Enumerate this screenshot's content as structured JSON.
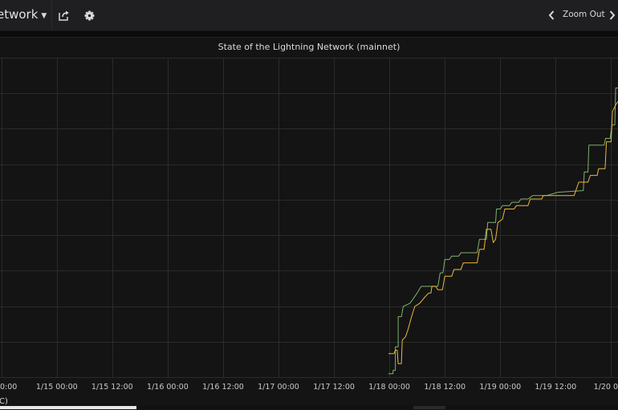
{
  "navbar": {
    "dashboard_title": "etwork",
    "share_icon": "share-icon",
    "settings_icon": "gear-icon",
    "zoom_out_label": "Zoom Out",
    "zoom_prev_icon": "chevron-left-icon",
    "zoom_next_icon": "chevron-right-icon"
  },
  "panel": {
    "title": "State of the Lightning Network (mainnet)",
    "legend_fragment": "C)"
  },
  "colors": {
    "series_green": "#7eb26d",
    "series_orange": "#eab839",
    "grid": "#2b2b2b",
    "background": "#141414"
  },
  "chart_data": {
    "type": "line",
    "title": "State of the Lightning Network (mainnet)",
    "xlabel": "",
    "ylabel": "",
    "grid": true,
    "y_ticks_visible": false,
    "x_tick_labels": [
      "0:00",
      "1/15 00:00",
      "1/15 12:00",
      "1/16 00:00",
      "1/16 12:00",
      "1/17 00:00",
      "1/17 12:00",
      "1/18 00:00",
      "1/18 12:00",
      "1/19 00:00",
      "1/19 12:00",
      "1/20 0"
    ],
    "x_hours": [
      -12,
      0,
      12,
      24,
      36,
      48,
      60,
      72,
      84,
      96,
      108,
      120
    ],
    "xlim_hours": [
      -12.3,
      121.5
    ],
    "ylim": [
      -0.1,
      9.4
    ],
    "series": [
      {
        "color": "#7eb26d",
        "points": [
          [
            71.8,
            0.0
          ],
          [
            72.8,
            0.0
          ],
          [
            72.8,
            0.1
          ],
          [
            73.3,
            0.1
          ],
          [
            73.3,
            0.8
          ],
          [
            73.9,
            0.8
          ],
          [
            73.9,
            1.7
          ],
          [
            74.6,
            1.7
          ],
          [
            75.0,
            2.0
          ],
          [
            76.5,
            2.1
          ],
          [
            78.0,
            2.4
          ],
          [
            78.9,
            2.6
          ],
          [
            80.5,
            2.6
          ],
          [
            82.5,
            2.6
          ],
          [
            83.0,
            3.0
          ],
          [
            83.6,
            3.0
          ],
          [
            84.0,
            3.4
          ],
          [
            85.0,
            3.4
          ],
          [
            85.5,
            3.5
          ],
          [
            87.0,
            3.5
          ],
          [
            87.5,
            3.6
          ],
          [
            91.0,
            3.6
          ],
          [
            91.5,
            4.0
          ],
          [
            93.0,
            4.0
          ],
          [
            93.3,
            4.5
          ],
          [
            95.0,
            4.5
          ],
          [
            95.2,
            4.9
          ],
          [
            96.0,
            4.9
          ],
          [
            96.5,
            5.0
          ],
          [
            98.0,
            5.0
          ],
          [
            98.5,
            5.1
          ],
          [
            100.0,
            5.1
          ],
          [
            100.5,
            5.2
          ],
          [
            102.0,
            5.2
          ],
          [
            103.0,
            5.3
          ],
          [
            106.0,
            5.3
          ],
          [
            108.5,
            5.4
          ],
          [
            114.0,
            5.45
          ],
          [
            114.2,
            6.0
          ],
          [
            115.0,
            6.0
          ],
          [
            115.2,
            6.8
          ],
          [
            116.0,
            6.8
          ],
          [
            118.5,
            6.8
          ],
          [
            118.8,
            7.0
          ],
          [
            119.8,
            7.0
          ],
          [
            120.2,
            7.4
          ],
          [
            120.8,
            7.4
          ],
          [
            121.0,
            8.5
          ],
          [
            121.5,
            8.5
          ]
        ]
      },
      {
        "color": "#eab839",
        "points": [
          [
            71.8,
            0.6
          ],
          [
            73.0,
            0.6
          ],
          [
            73.3,
            0.7
          ],
          [
            73.7,
            0.7
          ],
          [
            73.9,
            0.3
          ],
          [
            74.6,
            0.3
          ],
          [
            74.8,
            1.0
          ],
          [
            75.5,
            1.1
          ],
          [
            76.0,
            1.3
          ],
          [
            76.8,
            1.7
          ],
          [
            77.5,
            2.0
          ],
          [
            78.6,
            2.1
          ],
          [
            79.8,
            2.3
          ],
          [
            80.5,
            2.4
          ],
          [
            81.0,
            2.4
          ],
          [
            81.2,
            2.6
          ],
          [
            82.0,
            2.6
          ],
          [
            82.5,
            2.5
          ],
          [
            83.5,
            2.5
          ],
          [
            84.0,
            2.9
          ],
          [
            85.5,
            2.9
          ],
          [
            86.0,
            3.1
          ],
          [
            87.5,
            3.1
          ],
          [
            88.0,
            3.3
          ],
          [
            91.0,
            3.3
          ],
          [
            91.5,
            3.7
          ],
          [
            92.5,
            3.7
          ],
          [
            93.0,
            4.3
          ],
          [
            94.0,
            4.3
          ],
          [
            94.5,
            3.9
          ],
          [
            95.0,
            4.0
          ],
          [
            95.5,
            4.5
          ],
          [
            96.5,
            4.6
          ],
          [
            97.0,
            4.9
          ],
          [
            99.0,
            4.9
          ],
          [
            99.5,
            5.0
          ],
          [
            102.0,
            5.0
          ],
          [
            102.5,
            5.2
          ],
          [
            105.0,
            5.2
          ],
          [
            105.3,
            5.3
          ],
          [
            107.0,
            5.3
          ],
          [
            108.0,
            5.3
          ],
          [
            112.0,
            5.3
          ],
          [
            113.0,
            5.7
          ],
          [
            115.0,
            5.7
          ],
          [
            115.5,
            5.9
          ],
          [
            117.0,
            5.9
          ],
          [
            117.3,
            6.1
          ],
          [
            118.7,
            6.1
          ],
          [
            119.0,
            6.9
          ],
          [
            120.0,
            6.9
          ],
          [
            120.3,
            7.8
          ],
          [
            121.0,
            8.0
          ],
          [
            121.5,
            8.1
          ]
        ]
      }
    ]
  }
}
